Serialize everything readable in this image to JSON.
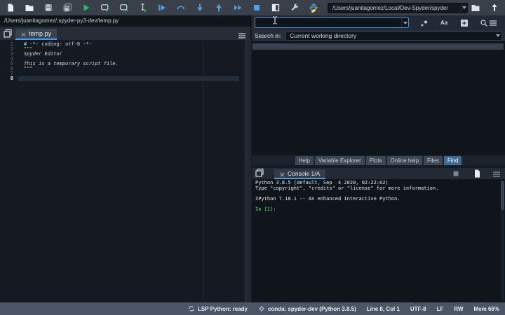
{
  "colors": {
    "accent_blue": "#4a9de5",
    "run_green": "#1fc25c",
    "debug_blue": "#4aa3e8",
    "toolbar_bg": "#3a4049",
    "content_bg": "#10151c",
    "statusbar_bg": "#4c5566",
    "string_green": "#69b56b",
    "comment_olive": "#999a6e",
    "prompt_green": "#3fae57"
  },
  "icons": {
    "toolbar": [
      "new-file",
      "open-file",
      "save-file",
      "save-all",
      "run-file",
      "run-cell",
      "run-cell-advance",
      "run-selection",
      "debug-file",
      "debug-step-over",
      "debug-step-into",
      "debug-step-return",
      "debug-continue",
      "debug-stop",
      "maximize-pane",
      "preferences-wrench",
      "python-path-manager",
      "browse-working-directory-folder",
      "parent-directory-up-arrow"
    ],
    "find_options": [
      "regex",
      "case-sensitive",
      "advanced-options",
      "search",
      "options-menu"
    ]
  },
  "toolbar": {
    "working_dir": "/Users/juanitagomez/Local/Dev-Spyder/spyder"
  },
  "editor": {
    "breadcrumb": "/Users/juanitagomez/.spyder-py3-dev/temp.py",
    "tab_label": "temp.py",
    "line_numbers": [
      "1",
      "2",
      "3",
      "4",
      "5",
      "6",
      "7",
      "8"
    ],
    "lines": [
      "# -*- coding: utf-8 -*-",
      "\"\"\"",
      "Spyder Editor",
      "",
      "This is a temporary script file.",
      "\"\"\"",
      "",
      ""
    ]
  },
  "find": {
    "search_value": "",
    "search_in_label": "Search in:",
    "search_in_value": "Current working directory"
  },
  "panel_tabs": [
    "Help",
    "Variable Explorer",
    "Plots",
    "Online help",
    "Files",
    "Find"
  ],
  "active_panel_tab": "Find",
  "console": {
    "tab_label": "Console 1/A",
    "banner": [
      "Python 3.8.5 (default, Sep  4 2020, 02:22:02)",
      "Type \"copyright\", \"credits\" or \"license\" for more information.",
      "",
      "IPython 7.18.1 -- An enhanced Interactive Python.",
      ""
    ],
    "prompt": "In [1]:"
  },
  "statusbar": {
    "lsp": "LSP Python: ready",
    "interpreter": "conda: spyder-dev (Python 3.8.5)",
    "cursor_position": "Line 8, Col 1",
    "encoding": "UTF-8",
    "eol": "LF",
    "permissions": "RW",
    "memory": "Mem 66%"
  }
}
